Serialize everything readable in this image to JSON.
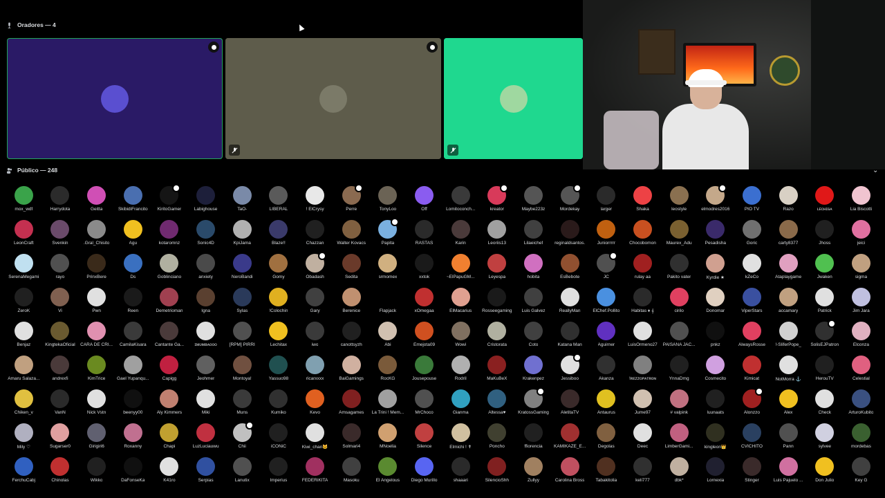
{
  "speakers_header": "Oradores — 4",
  "audience_header": "Público — 248",
  "tiles": [
    {
      "bg": "#2a1a66",
      "border": "#23a55a",
      "avatar": "#5a4fd0",
      "badge": true,
      "muted": false
    },
    {
      "bg": "#5e5c4b",
      "border": "#5e5c4b",
      "avatar": "#7b7a68",
      "badge": true,
      "muted": true
    },
    {
      "bg": "#1fd88f",
      "border": "#1fd88f",
      "avatar": "#9fd8a0",
      "badge": false,
      "muted": true
    }
  ],
  "members": [
    {
      "name": "mox_wdf",
      "color": "#3aa34a"
    },
    {
      "name": "Harrydota",
      "color": "#2b2b2b"
    },
    {
      "name": "Geitta",
      "color": "#d04fb5"
    },
    {
      "name": "SkibidiFrancito",
      "color": "#4a6fb0"
    },
    {
      "name": "KiritoGamer",
      "color": "#151515",
      "dot": true
    },
    {
      "name": "Labighouse",
      "color": "#1d1f3a"
    },
    {
      "name": "TaO-",
      "color": "#7a8aa8"
    },
    {
      "name": "LIBERAL",
      "color": "#5a5a5a"
    },
    {
      "name": "! ElCrysy",
      "color": "#e8e8e8"
    },
    {
      "name": "Perre",
      "color": "#8a6a50",
      "dot": true
    },
    {
      "name": "TonyLoo",
      "color": "#6b6355"
    },
    {
      "name": "Off",
      "color": "#8a5cf0"
    },
    {
      "name": "Lomitoconch...",
      "color": "#3a3a3a"
    },
    {
      "name": "kreator",
      "color": "#d83a5a",
      "dot": true
    },
    {
      "name": "Maybe223z",
      "color": "#555555"
    },
    {
      "name": "Mordekay",
      "color": "#555555",
      "dot": true
    },
    {
      "name": "larger",
      "color": "#2a2a2a"
    },
    {
      "name": "Shaka",
      "color": "#ed4245"
    },
    {
      "name": "leostyle",
      "color": "#8a7050"
    },
    {
      "name": "elmodres2016",
      "color": "#c4a88a",
      "dot": true
    },
    {
      "name": "PIO TV",
      "color": "#3b6fd0"
    },
    {
      "name": "Razo",
      "color": "#d8d0c4"
    },
    {
      "name": "ʟᴇᴄʜɪɢᴀ",
      "color": "#e01818"
    },
    {
      "name": "Lia Biscotti",
      "color": "#f0c4d0"
    },
    {
      "name": "LeonCraft",
      "color": "#c43050"
    },
    {
      "name": "Svenkin",
      "color": "#6a4a6a"
    },
    {
      "name": ".Gral_Chisito",
      "color": "#8a8a8a"
    },
    {
      "name": "Agu",
      "color": "#f0c020"
    },
    {
      "name": "kotaromnz",
      "color": "#702a70"
    },
    {
      "name": "Sonic4D",
      "color": "#2a4a6a"
    },
    {
      "name": "KpiJama",
      "color": "#b0b0b0"
    },
    {
      "name": "Blaze!!",
      "color": "#3a3a6a"
    },
    {
      "name": "Chazzan",
      "color": "#202020"
    },
    {
      "name": "Walter Kovacs",
      "color": "#806040"
    },
    {
      "name": "Papita",
      "color": "#7ab0e0",
      "dot": true
    },
    {
      "name": "RASTAS",
      "color": "#2a2a2a"
    },
    {
      "name": "Karin",
      "color": "#4a3a3a"
    },
    {
      "name": "Leoriis13",
      "color": "#a0a0a0"
    },
    {
      "name": "Lilaeichef",
      "color": "#404040"
    },
    {
      "name": "reginaldsantos.",
      "color": "#2a1a1a"
    },
    {
      "name": "Juniorrrrr",
      "color": "#c06010"
    },
    {
      "name": "Chocobomon",
      "color": "#c85020"
    },
    {
      "name": "Maurex_Adu",
      "color": "#7a6030"
    },
    {
      "name": "Pesadisha",
      "color": "#3a2a6a"
    },
    {
      "name": "Goric",
      "color": "#707070"
    },
    {
      "name": "carty8377",
      "color": "#8a6a4a"
    },
    {
      "name": "Jhoss",
      "color": "#202020"
    },
    {
      "name": "jeici",
      "color": "#e070a0"
    },
    {
      "name": "SerenaMegami",
      "color": "#c0e0f0"
    },
    {
      "name": "rayo",
      "color": "#505050"
    },
    {
      "name": "PrinxBere",
      "color": "#3a2a1a"
    },
    {
      "name": "Ds",
      "color": "#3a70c0"
    },
    {
      "name": "Goblinciano",
      "color": "#b0b0a0"
    },
    {
      "name": "anxiety",
      "color": "#4a4a4a"
    },
    {
      "name": "NeroBandi",
      "color": "#3a3a8a"
    },
    {
      "name": "Gomy",
      "color": "#a07040"
    },
    {
      "name": "Obadash",
      "color": "#c0b0a0",
      "dot": true
    },
    {
      "name": "Sedita",
      "color": "#6a3a2a"
    },
    {
      "name": "srmomex",
      "color": "#d0b080"
    },
    {
      "name": "xxtok",
      "color": "#1a1a1a"
    },
    {
      "name": "~ElPapuGM...",
      "color": "#f08030"
    },
    {
      "name": "Leyespa",
      "color": "#c04040"
    },
    {
      "name": "hobita",
      "color": "#d070c0"
    },
    {
      "name": "EsBebote",
      "color": "#905030"
    },
    {
      "name": "JC",
      "color": "#505050",
      "dot": true
    },
    {
      "name": "rulay aa",
      "color": "#a02020"
    },
    {
      "name": "Pakito vater",
      "color": "#303030"
    },
    {
      "name": "Kyrdie ★",
      "color": "#d0a090"
    },
    {
      "name": "kZeCo",
      "color": "#e0e0e0"
    },
    {
      "name": "Ataplaygame",
      "color": "#e0a0c0"
    },
    {
      "name": "Jwaken",
      "color": "#50c050"
    },
    {
      "name": "sigma",
      "color": "#c0a080"
    },
    {
      "name": "ZeroK",
      "color": "#202020"
    },
    {
      "name": "Vi",
      "color": "#806050"
    },
    {
      "name": "Pwn",
      "color": "#e0e0e0"
    },
    {
      "name": "Reen",
      "color": "#1a1a1a"
    },
    {
      "name": "Demetrioman",
      "color": "#a04050"
    },
    {
      "name": "Igna",
      "color": "#5a4030"
    },
    {
      "name": "Sylas",
      "color": "#2a3a5a"
    },
    {
      "name": "!Colochin",
      "color": "#e0b020"
    },
    {
      "name": "Gary",
      "color": "#404040"
    },
    {
      "name": "Berenice",
      "color": "#c09070"
    },
    {
      "name": "Flapjack",
      "color": "#000000"
    },
    {
      "name": "xOmegaa",
      "color": "#c03030"
    },
    {
      "name": "ElMacarius",
      "color": "#e0a090"
    },
    {
      "name": "Rosseegaming",
      "color": "#1a1a1a"
    },
    {
      "name": "Luis Galvez",
      "color": "#404040"
    },
    {
      "name": "ReallyMan",
      "color": "#e0e0e0"
    },
    {
      "name": "ElChef.Pollito",
      "color": "#4a90e0"
    },
    {
      "name": "Habitas ♦ 𝄞",
      "color": "#2a2a2a"
    },
    {
      "name": "cirilo",
      "color": "#e04060"
    },
    {
      "name": "Donomar",
      "color": "#e0d0c0"
    },
    {
      "name": "ViperStars",
      "color": "#3a50a0"
    },
    {
      "name": "accamary",
      "color": "#c0a080"
    },
    {
      "name": "Patrick",
      "color": "#e0e0e0"
    },
    {
      "name": "Jim Jara",
      "color": "#c0c0e0"
    },
    {
      "name": "Benjaz",
      "color": "#e0e0e0"
    },
    {
      "name": "KingtekaOficial",
      "color": "#6a5a30"
    },
    {
      "name": "CARA DE CRI...",
      "color": "#e090b0"
    },
    {
      "name": "CamilaKisara",
      "color": "#3a3a3a"
    },
    {
      "name": "Cantante Ga...",
      "color": "#4a3a3a"
    },
    {
      "name": "ɪᴍᴜᴍʙᴀᴏᴏᴏ",
      "color": "#e0e0e0"
    },
    {
      "name": "[RPM] PIRRI",
      "color": "#505050"
    },
    {
      "name": "Lechitax",
      "color": "#f0c020"
    },
    {
      "name": "iwo",
      "color": "#3a3a3a"
    },
    {
      "name": "canottsyzh",
      "color": "#202020"
    },
    {
      "name": "Abi",
      "color": "#d0c0b0"
    },
    {
      "name": "Emejota09",
      "color": "#d05020"
    },
    {
      "name": "Wowi",
      "color": "#807060"
    },
    {
      "name": "Cristorata",
      "color": "#b0b0a0"
    },
    {
      "name": "Coto",
      "color": "#404040"
    },
    {
      "name": "Katana Man",
      "color": "#303030"
    },
    {
      "name": "Aguirner",
      "color": "#6030c0"
    },
    {
      "name": "LuisOrmeno27",
      "color": "#e0e0e0"
    },
    {
      "name": "PAISANA JAC...",
      "color": "#505050"
    },
    {
      "name": "pnkz",
      "color": "#101010"
    },
    {
      "name": "AlwaysRosse",
      "color": "#e04060"
    },
    {
      "name": "!-SliferPope_",
      "color": "#d0d0d0"
    },
    {
      "name": "SolisEJPatron",
      "color": "#303030",
      "dot": true
    },
    {
      "name": "Elconza",
      "color": "#e0b0c0"
    },
    {
      "name": "Amaru Salaza...",
      "color": "#c0a080"
    },
    {
      "name": "andrexfi",
      "color": "#4a3a3a"
    },
    {
      "name": "KimTrice",
      "color": "#6a8a20"
    },
    {
      "name": "Gael Yupanqu...",
      "color": "#a0a0a0"
    },
    {
      "name": "Capigg",
      "color": "#c02040"
    },
    {
      "name": "Jeohmer",
      "color": "#606060"
    },
    {
      "name": "Montoya!",
      "color": "#705040"
    },
    {
      "name": "Yassuo98",
      "color": "#205050"
    },
    {
      "name": "ricarxxxx",
      "color": "#80a0b0"
    },
    {
      "name": "BaiGamings",
      "color": "#d0b0a0"
    },
    {
      "name": "RocKG",
      "color": "#7a5a3a"
    },
    {
      "name": "Jousepouse",
      "color": "#3a7a3a"
    },
    {
      "name": "Rodril",
      "color": "#b0b0b0"
    },
    {
      "name": "MaKuBeX",
      "color": "#8a2020"
    },
    {
      "name": "Krakenpez",
      "color": "#7070d0"
    },
    {
      "name": "Jessiboo",
      "color": "#e0e0e0",
      "dot": true
    },
    {
      "name": "Akanza",
      "color": "#303030"
    },
    {
      "name": "!ʀᴇᴢᴢᴏᴘᴀᴛʀᴏɴ",
      "color": "#808080"
    },
    {
      "name": "YnnaDmg",
      "color": "#202020"
    },
    {
      "name": "Cosmecito",
      "color": "#d0a0e0"
    },
    {
      "name": "Kimicat",
      "color": "#c03030"
    },
    {
      "name": "NotMorra ⚓",
      "color": "#e0e0e0"
    },
    {
      "name": "HerouTV",
      "color": "#202020"
    },
    {
      "name": "Celestial",
      "color": "#e06080"
    },
    {
      "name": "Chiken_v",
      "color": "#e0c040"
    },
    {
      "name": "VanN",
      "color": "#2a2a2a"
    },
    {
      "name": "Nick Vstn",
      "color": "#e0e0e0"
    },
    {
      "name": "beenyy00",
      "color": "#101010"
    },
    {
      "name": "Aly Kimmers",
      "color": "#c08070"
    },
    {
      "name": "Miki",
      "color": "#e0e0e0"
    },
    {
      "name": "Muns",
      "color": "#3a3a3a"
    },
    {
      "name": "Kumiko",
      "color": "#303030"
    },
    {
      "name": "Kevo",
      "color": "#e06020"
    },
    {
      "name": "Amsagames",
      "color": "#802020"
    },
    {
      "name": "La Trini ! Mem...",
      "color": "#a0a0a0"
    },
    {
      "name": "MrChoco",
      "color": "#505050"
    },
    {
      "name": "Gianma",
      "color": "#30a0c0"
    },
    {
      "name": "Altessa♥",
      "color": "#306080"
    },
    {
      "name": "KratossGaming",
      "color": "#808080",
      "dot": true
    },
    {
      "name": "AletitaTV",
      "color": "#3a2a2a"
    },
    {
      "name": "Antaurus",
      "color": "#e0c020"
    },
    {
      "name": "Jume97",
      "color": "#d0c0b0"
    },
    {
      "name": "# valpink",
      "color": "#c07080"
    },
    {
      "name": "luunaats",
      "color": "#202020"
    },
    {
      "name": "Alonzzo",
      "color": "#a02020",
      "dot": true
    },
    {
      "name": "Alex",
      "color": "#f0c020"
    },
    {
      "name": "Check",
      "color": "#e0e0e0"
    },
    {
      "name": "ArturoKubito",
      "color": "#3a5080"
    },
    {
      "name": "Mily ♡",
      "color": "#b0b0c0"
    },
    {
      "name": "Sugarser0",
      "color": "#e0a0a0"
    },
    {
      "name": "Girigiri6",
      "color": "#606070"
    },
    {
      "name": "Roxanny",
      "color": "#c07090"
    },
    {
      "name": "Chapi",
      "color": "#c0a030"
    },
    {
      "name": "LuzLuciauwu",
      "color": "#c03040"
    },
    {
      "name": "Chii",
      "color": "#c0c0c0",
      "dot": true
    },
    {
      "name": "iCONiC",
      "color": "#202020"
    },
    {
      "name": "Kiwi_chan🐱",
      "color": "#e0e0e0"
    },
    {
      "name": "Solmari4",
      "color": "#3a2a2a"
    },
    {
      "name": "MNoelia",
      "color": "#d0a070"
    },
    {
      "name": "Silence",
      "color": "#c04040"
    },
    {
      "name": "Elmichi ! ✝",
      "color": "#d0c0a0"
    },
    {
      "name": "Poncho",
      "color": "#404030"
    },
    {
      "name": "ffiorencia",
      "color": "#202020"
    },
    {
      "name": "KAMIKAZE_E...",
      "color": "#a03030"
    },
    {
      "name": "Degolas",
      "color": "#806040"
    },
    {
      "name": "Deec",
      "color": "#e0e0e0"
    },
    {
      "name": "LimberGami...",
      "color": "#c06080"
    },
    {
      "name": "kingleon👑",
      "color": "#303020"
    },
    {
      "name": "CVICHITO",
      "color": "#2a4060"
    },
    {
      "name": "Pann",
      "color": "#505050"
    },
    {
      "name": "sylvee",
      "color": "#d0d0e0"
    },
    {
      "name": "mordebas",
      "color": "#3a6030"
    },
    {
      "name": "FerchuCabj",
      "color": "#3060c0"
    },
    {
      "name": "Chinolas",
      "color": "#c03030"
    },
    {
      "name": "Wikko",
      "color": "#202020"
    },
    {
      "name": "DaFonseKa",
      "color": "#101010"
    },
    {
      "name": "K41ro",
      "color": "#e0e0e0"
    },
    {
      "name": "Serpias",
      "color": "#3050a0"
    },
    {
      "name": "Lanutix",
      "color": "#505050"
    },
    {
      "name": "Imperius",
      "color": "#202020"
    },
    {
      "name": "FEDERiKITA",
      "color": "#a03060"
    },
    {
      "name": "Masoku",
      "color": "#404040"
    },
    {
      "name": "El Angelous",
      "color": "#5a8a30"
    },
    {
      "name": "Diego Murillo",
      "color": "#5865f2"
    },
    {
      "name": "shaaari",
      "color": "#2a2a2a"
    },
    {
      "name": "SilencioShh",
      "color": "#802020"
    },
    {
      "name": "Zullyy",
      "color": "#a08060"
    },
    {
      "name": "Carolina Bross",
      "color": "#c05060"
    },
    {
      "name": "Tabakitolia",
      "color": "#503020"
    },
    {
      "name": "keli777",
      "color": "#303030"
    },
    {
      "name": "dbk*",
      "color": "#c0b0a0"
    },
    {
      "name": "Lornexia",
      "color": "#202030"
    },
    {
      "name": "Stinger",
      "color": "#3a2a2a"
    },
    {
      "name": "Luis Pajuelo ...",
      "color": "#d070a0"
    },
    {
      "name": "Don Julio",
      "color": "#f0c020"
    },
    {
      "name": "Key G",
      "color": "#404040"
    }
  ]
}
